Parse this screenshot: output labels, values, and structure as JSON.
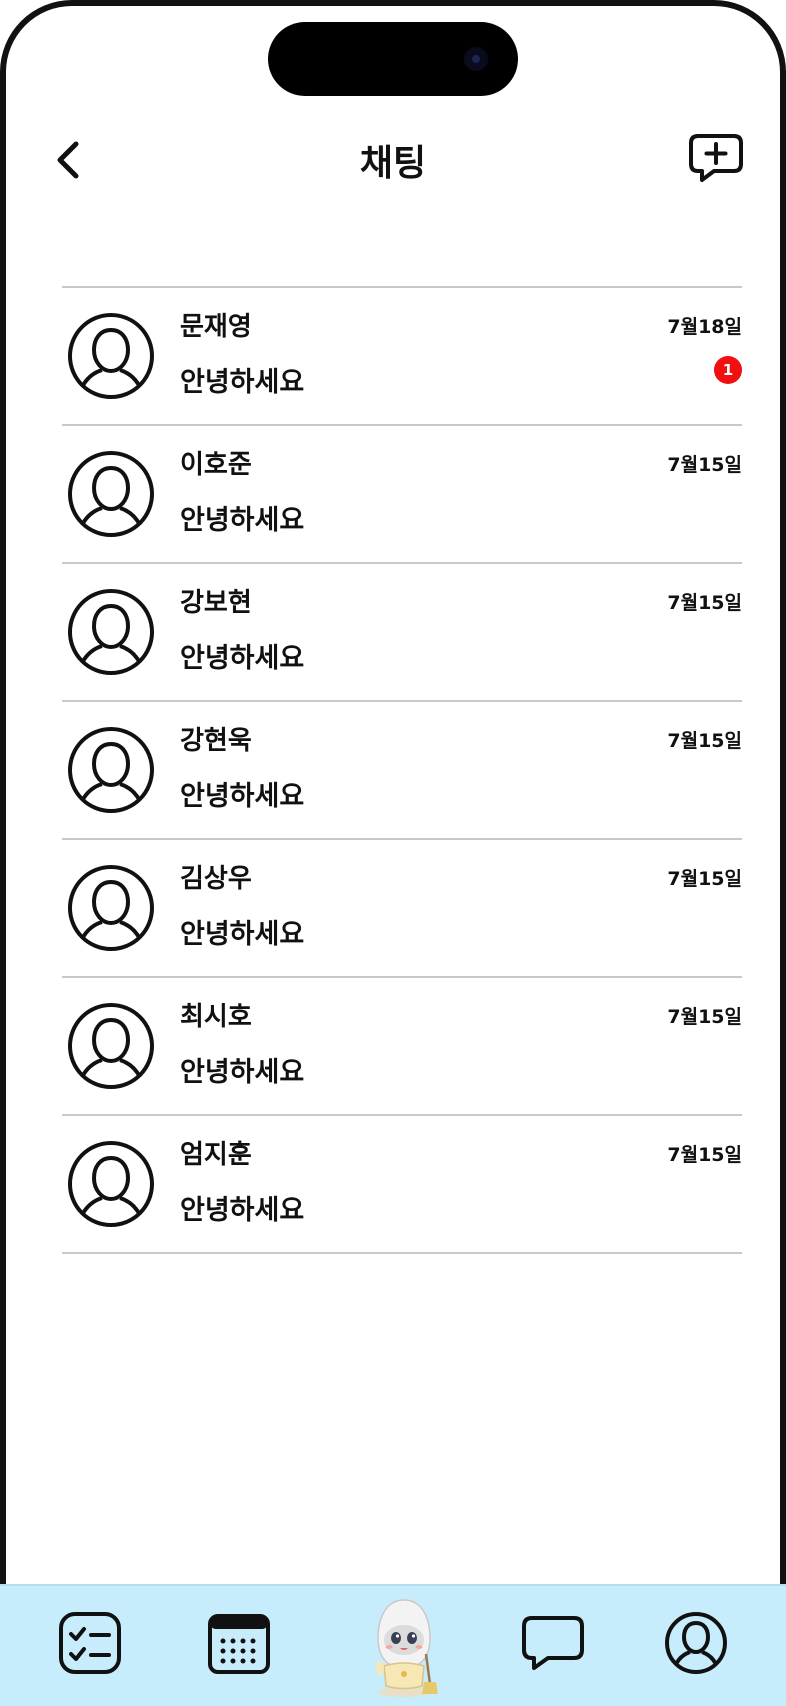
{
  "header": {
    "title": "채팅"
  },
  "chats": [
    {
      "name": "문재영",
      "message": "안녕하세요",
      "date": "7월18일",
      "unread": "1"
    },
    {
      "name": "이호준",
      "message": "안녕하세요",
      "date": "7월15일"
    },
    {
      "name": "강보현",
      "message": "안녕하세요",
      "date": "7월15일"
    },
    {
      "name": "강현욱",
      "message": "안녕하세요",
      "date": "7월15일"
    },
    {
      "name": "김상우",
      "message": "안녕하세요",
      "date": "7월15일"
    },
    {
      "name": "최시호",
      "message": "안녕하세요",
      "date": "7월15일"
    },
    {
      "name": "엄지훈",
      "message": "안녕하세요",
      "date": "7월15일"
    }
  ],
  "colors": {
    "tabbar_bg": "#c7ecfb",
    "badge": "#f01010",
    "divider": "#c8c8c8",
    "text": "#111111"
  },
  "icons": {
    "back": "chevron-left-icon",
    "new_chat": "chat-plus-icon",
    "avatar": "user-avatar-icon",
    "tabs": [
      "checklist-icon",
      "calendar-icon",
      "mascot-robot-icon",
      "chat-bubble-icon",
      "profile-icon"
    ]
  }
}
